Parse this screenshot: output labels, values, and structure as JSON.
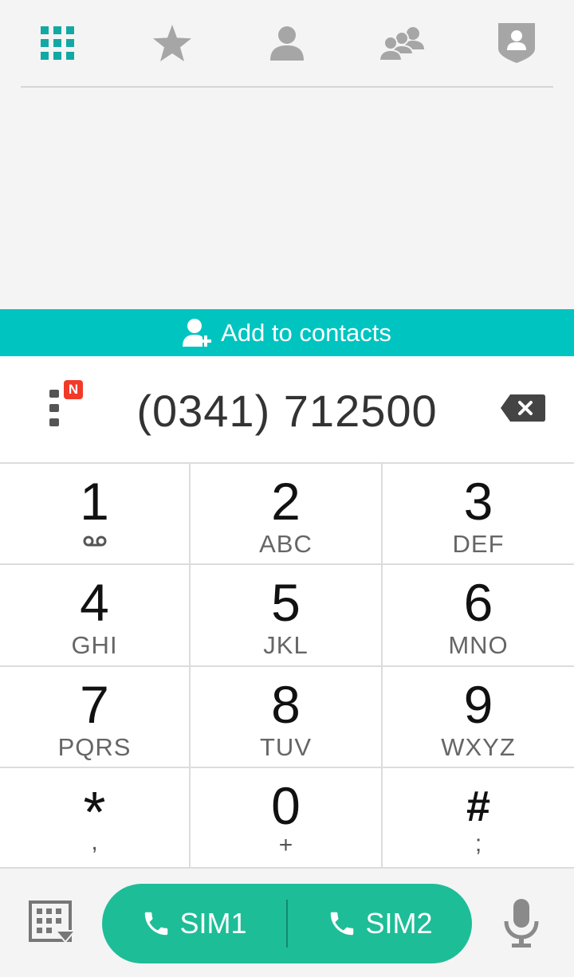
{
  "tabs": [
    {
      "icon": "dialpad-grid-icon",
      "active": true,
      "color": "#13a8a4"
    },
    {
      "icon": "star-icon",
      "active": false
    },
    {
      "icon": "person-icon",
      "active": false
    },
    {
      "icon": "group-icon",
      "active": false
    },
    {
      "icon": "shield-person-icon",
      "active": false
    }
  ],
  "add_bar": {
    "label": "Add to contacts",
    "color": "#00c4c0"
  },
  "dialer": {
    "number": "(0341) 712500",
    "badge": "N"
  },
  "keys": [
    {
      "digit": "1",
      "sub": "voicemail"
    },
    {
      "digit": "2",
      "sub": "ABC"
    },
    {
      "digit": "3",
      "sub": "DEF"
    },
    {
      "digit": "4",
      "sub": "GHI"
    },
    {
      "digit": "5",
      "sub": "JKL"
    },
    {
      "digit": "6",
      "sub": "MNO"
    },
    {
      "digit": "7",
      "sub": "PQRS"
    },
    {
      "digit": "8",
      "sub": "TUV"
    },
    {
      "digit": "9",
      "sub": "WXYZ"
    },
    {
      "digit": "*",
      "sub": ","
    },
    {
      "digit": "0",
      "sub": "+"
    },
    {
      "digit": "#",
      "sub": ";"
    }
  ],
  "call": {
    "sim1_label": "SIM1",
    "sim2_label": "SIM2",
    "color": "#1dbd97"
  }
}
